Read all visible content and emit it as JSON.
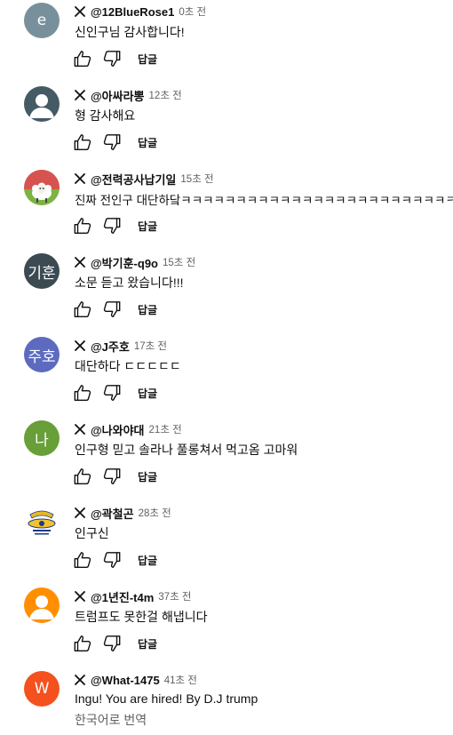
{
  "reply_label": "답글",
  "translate_label": "한국어로 번역",
  "comments": [
    {
      "author": "@12BlueRose1",
      "time": "0초 전",
      "text": "신인구님 감사합니다!",
      "avatar_letter": "e",
      "avatar_color": "#78909c"
    },
    {
      "author": "@아싸라뽕",
      "time": "12초 전",
      "text": "형 감사해요",
      "avatar_letter": "",
      "avatar_color": "#455a64"
    },
    {
      "author": "@전력공사납기일",
      "time": "15초 전",
      "text": "진짜 전인구 대단하닼ㅋㅋㅋㅋㅋㅋㅋㅋㅋㅋㅋㅋㅋㅋㅋㅋㅋㅋㅋㅋㅋㅋㅋㅋㅋ",
      "avatar_letter": "",
      "avatar_color": "#c9e3c0"
    },
    {
      "author": "@박기훈-q9o",
      "time": "15초 전",
      "text": "소문 듣고 왔습니다!!!",
      "avatar_letter": "기훈",
      "avatar_color": "#3c4a52"
    },
    {
      "author": "@J주호",
      "time": "17초 전",
      "text": "대단하다 ㄷㄷㄷㄷㄷ",
      "avatar_letter": "주호",
      "avatar_color": "#5c6bc0"
    },
    {
      "author": "@나와야대",
      "time": "21초 전",
      "text": "인구형 믿고 솔라나 풀롱쳐서 먹고옴  고마워",
      "avatar_letter": "나",
      "avatar_color": "#689f38"
    },
    {
      "author": "@곽철곤",
      "time": "28초 전",
      "text": "인구신",
      "avatar_letter": "",
      "avatar_color": "#ffffff"
    },
    {
      "author": "@1년진-t4m",
      "time": "37초 전",
      "text": "트럼프도 못한걸 해냅니다",
      "avatar_letter": "",
      "avatar_color": "#ff8f00"
    },
    {
      "author": "@What-1475",
      "time": "41초 전",
      "text": "Ingu! You are hired! By D.J trump",
      "avatar_letter": "W",
      "avatar_color": "#f4511e"
    }
  ]
}
